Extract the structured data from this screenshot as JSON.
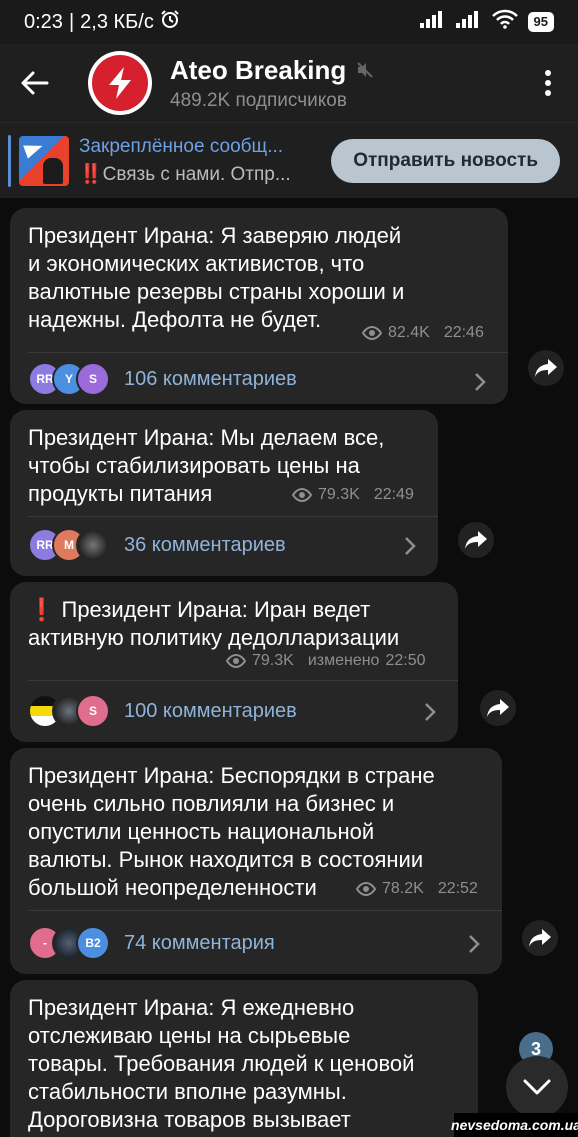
{
  "status_bar": {
    "time": "0:23",
    "separator": "|",
    "speed": "2,3 КБ/с",
    "battery": "95"
  },
  "header": {
    "title": "Ateo Breaking",
    "subtitle": "489.2K подписчиков"
  },
  "pinned": {
    "title": "Закреплённое сообщ...",
    "body": "‼️Связь с нами.  Отпр...",
    "send_button": "Отправить новость"
  },
  "messages": [
    {
      "text": "Президент Ирана: Я заверяю людей\nи экономических активистов, что\nвалютные резервы страны хороши и\nнадежны. Дефолта не будет.",
      "views": "82.4K",
      "time": "22:46",
      "comments": "106 комментариев",
      "avatars": [
        {
          "label": "RR",
          "color": "#8e7be0"
        },
        {
          "label": "Y",
          "color": "#4c8fe0"
        },
        {
          "label": "S",
          "color": "#9b6bdc"
        }
      ]
    },
    {
      "text": "Президент Ирана: Мы делаем все,\nчтобы стабилизировать цены на\nпродукты питания",
      "views": "79.3K",
      "time": "22:49",
      "comments": "36 комментариев",
      "avatars": [
        {
          "label": "RR",
          "color": "#8e7be0"
        },
        {
          "label": "M",
          "color": "#e07a5f"
        },
        {
          "label": "",
          "color": "#3a3a3a"
        }
      ]
    },
    {
      "text": "❗ Президент Ирана: Иран ведет\nактивную политику дедолларизации",
      "views": "79.3K",
      "edited": "изменено",
      "time": "22:50",
      "comments": "100 комментариев",
      "avatars": [
        {
          "label": "",
          "color": "#f5d90a"
        },
        {
          "label": "",
          "color": "#3a4048"
        },
        {
          "label": "S",
          "color": "#e06c8e"
        }
      ]
    },
    {
      "text": "Президент Ирана: Беспорядки в стране\nочень сильно повлияли на бизнес и\nопустили ценность национальной\nвалюты. Рынок находится в состоянии\nбольшой неопределенности",
      "views": "78.2K",
      "time": "22:52",
      "comments": "74 комментария",
      "avatars": [
        {
          "label": "-",
          "color": "#e06c8e"
        },
        {
          "label": "",
          "color": "#2b3440"
        },
        {
          "label": "B2",
          "color": "#4c8fe0"
        }
      ]
    },
    {
      "text": "Президент Ирана: Я ежедневно\nотслеживаю цены на сырьевые\nтовары. Требования людей к ценовой\nстабильности вполне разумны.\nДороговизна товаров вызывает"
    }
  ],
  "unread_count": "3",
  "watermark": "nevsedoma.com.ua",
  "colors": {
    "accent": "#8fb3d9",
    "bubble": "#262626",
    "brand_red": "#d6202d"
  }
}
